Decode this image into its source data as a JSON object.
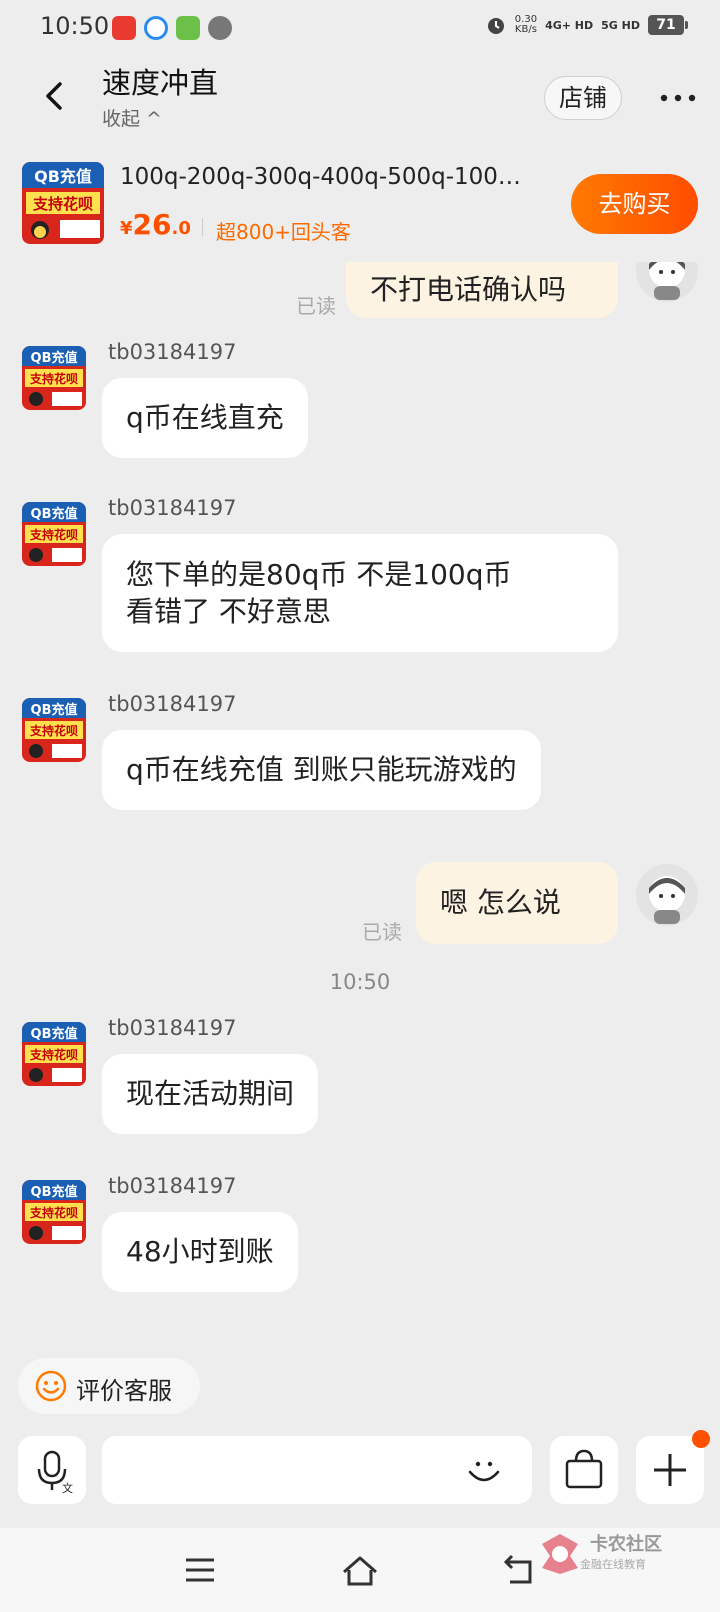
{
  "status_bar": {
    "time": "10:50",
    "net_speed": "0.30",
    "net_unit": "KB/s",
    "signal1": "4G+ HD",
    "signal2": "5G HD",
    "battery": "71"
  },
  "header": {
    "title": "速度冲直",
    "subtitle": "收起 ^",
    "store_label": "店铺"
  },
  "product": {
    "name": "100q-200q-300q-400q-500q-100…",
    "currency": "¥",
    "price_int": "26",
    "price_dec": ".0",
    "repeat_customers": "超800+回头客",
    "buy_label": "去购买",
    "image_lines": [
      "QB充值",
      "支持花呗"
    ]
  },
  "messages": [
    {
      "dir": "out",
      "text": "不打电话确认吗",
      "status": "已读"
    },
    {
      "dir": "in",
      "sender": "tb03184197",
      "text": "q币在线直充"
    },
    {
      "dir": "in",
      "sender": "tb03184197",
      "lines": [
        "您下单的是80q币  不是100q币",
        "看错了 不好意思"
      ]
    },
    {
      "dir": "in",
      "sender": "tb03184197",
      "text": "q币在线充值 到账只能玩游戏的"
    },
    {
      "dir": "out",
      "text": "嗯   怎么说",
      "status": "已读"
    },
    {
      "dir": "time",
      "text": "10:50"
    },
    {
      "dir": "in",
      "sender": "tb03184197",
      "text": "现在活动期间"
    },
    {
      "dir": "in",
      "sender": "tb03184197",
      "text": "48小时到账"
    }
  ],
  "rate_button": {
    "label": "评价客服"
  },
  "watermark": {
    "title": "卡农社区",
    "subtitle": "金融在线教育"
  },
  "colors": {
    "accent": "#ff5000",
    "out_bubble": "#fdf3e3",
    "background": "#ededed"
  }
}
